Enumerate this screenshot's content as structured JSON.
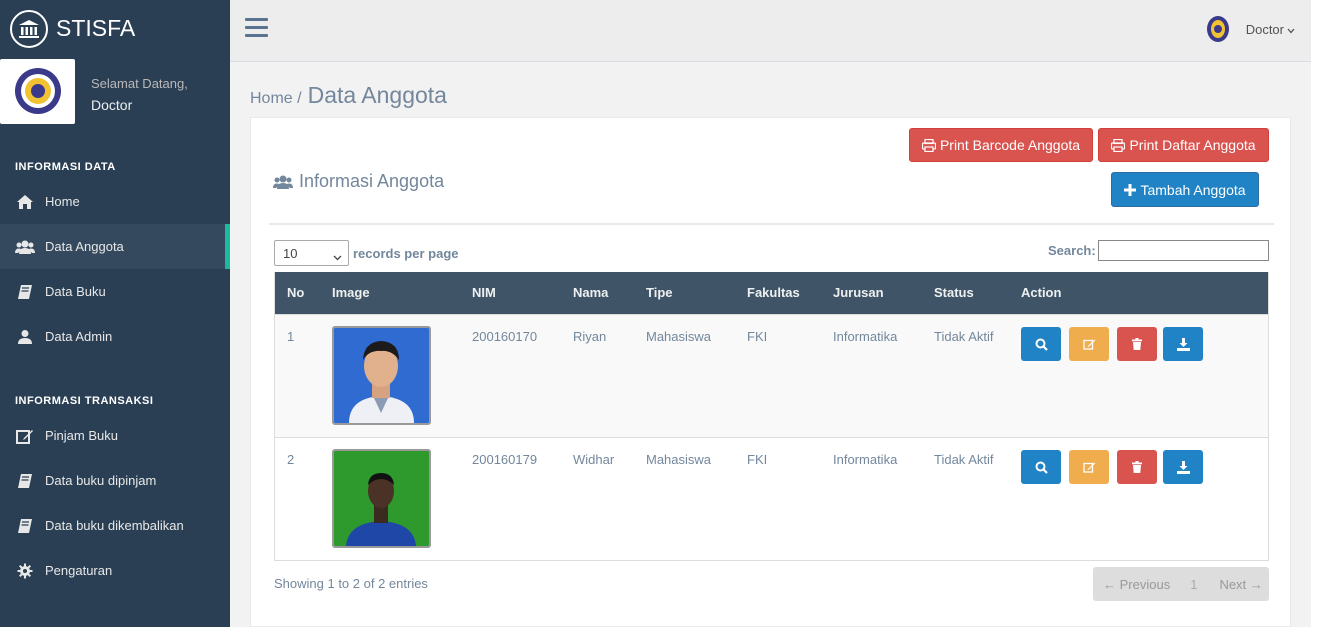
{
  "app": {
    "title": "STISFA"
  },
  "profile": {
    "welcome": "Selamat Datang,",
    "name": "Doctor"
  },
  "sidebar": {
    "section1": "INFORMASI DATA",
    "items1": [
      {
        "label": "Home",
        "icon": "home-icon"
      },
      {
        "label": "Data Anggota",
        "icon": "users-icon"
      },
      {
        "label": "Data Buku",
        "icon": "book-icon"
      },
      {
        "label": "Data Admin",
        "icon": "user-icon"
      }
    ],
    "section2": "INFORMASI TRANSAKSI",
    "items2": [
      {
        "label": "Pinjam Buku",
        "icon": "edit-icon"
      },
      {
        "label": "Data buku dipinjam",
        "icon": "book-icon"
      },
      {
        "label": "Data buku dikembalikan",
        "icon": "book-icon"
      },
      {
        "label": "Pengaturan",
        "icon": "gear-icon"
      }
    ]
  },
  "topbar": {
    "user": "Doctor"
  },
  "breadcrumb": {
    "home": "Home /",
    "title": "Data Anggota"
  },
  "panel": {
    "title": "Informasi Anggota",
    "print_barcode": "Print Barcode Anggota",
    "print_list": "Print Daftar Anggota",
    "add": "Tambah Anggota"
  },
  "table_controls": {
    "length_value": "10",
    "length_label": "records per page",
    "search_label": "Search:",
    "search_value": ""
  },
  "table": {
    "headers": [
      "No",
      "Image",
      "NIM",
      "Nama",
      "Tipe",
      "Fakultas",
      "Jurusan",
      "Status",
      "Action"
    ],
    "rows": [
      {
        "no": "1",
        "nim": "200160170",
        "nama": "Riyan",
        "tipe": "Mahasiswa",
        "fakultas": "FKI",
        "jurusan": "Informatika",
        "status": "Tidak Aktif"
      },
      {
        "no": "2",
        "nim": "200160179",
        "nama": "Widhar",
        "tipe": "Mahasiswa",
        "fakultas": "FKI",
        "jurusan": "Informatika",
        "status": "Tidak Aktif"
      }
    ]
  },
  "footer": {
    "info": "Showing 1 to 2 of 2 entries",
    "previous": "← Previous",
    "page": "1",
    "next": "Next →"
  },
  "colors": {
    "sidebar": "#2a3f54",
    "active_accent": "#1abb9c",
    "table_header": "#405467",
    "primary": "#1f83c5",
    "danger": "#d9534f",
    "warning": "#f0ad4e"
  }
}
